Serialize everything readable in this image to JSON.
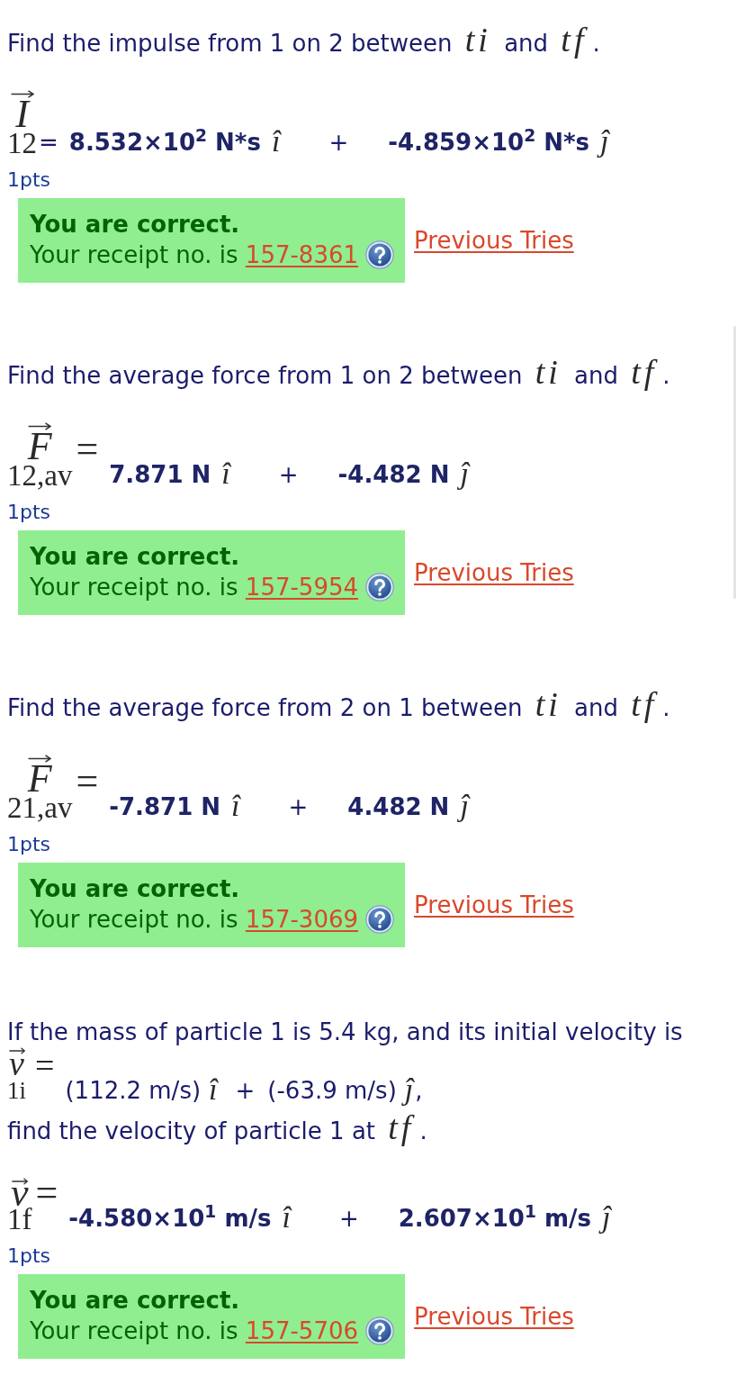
{
  "parts": [
    {
      "prompt": [
        {
          "kind": "text",
          "text": "Find the impulse from 1 on 2 between *ti* and *tf*."
        }
      ],
      "answer": {
        "label": {
          "symbol": "I",
          "subscript": "12"
        },
        "equals": "=",
        "terms": [
          {
            "kind": "component",
            "value": "8.532×10$^{2}$ N*s",
            "unit": "î"
          },
          {
            "kind": "operator",
            "text": "+"
          },
          {
            "kind": "component",
            "value": "-4.859×10$^{2}$ N*s",
            "unit": "ĵ"
          }
        ]
      },
      "points": "1pts",
      "feedback": {
        "correct": true,
        "status": "You are correct.",
        "receipt_text": "Your receipt no. is",
        "receipt": "157-8361"
      },
      "previous_tries": "Previous Tries"
    },
    {
      "prompt": [
        {
          "kind": "text",
          "text": "Find the average force from 1 on 2 between *ti* and *tf*."
        }
      ],
      "answer": {
        "label": {
          "symbol": "F",
          "subscript": "12,av",
          "equals": "="
        },
        "terms": [
          {
            "kind": "component",
            "value": "7.871 N",
            "unit": "î"
          },
          {
            "kind": "operator",
            "text": "+"
          },
          {
            "kind": "component",
            "value": "-4.482 N",
            "unit": "ĵ"
          }
        ]
      },
      "points": "1pts",
      "feedback": {
        "correct": true,
        "status": "You are correct.",
        "receipt_text": "Your receipt no. is",
        "receipt": "157-5954"
      },
      "previous_tries": "Previous Tries"
    },
    {
      "prompt": [
        {
          "kind": "text",
          "text": "Find the average force from 2 on 1 between *ti* and *tf*."
        }
      ],
      "answer": {
        "label": {
          "symbol": "F",
          "subscript": "21,av",
          "equals": "="
        },
        "terms": [
          {
            "kind": "component",
            "value": "-7.871 N",
            "unit": "î"
          },
          {
            "kind": "operator",
            "text": "+"
          },
          {
            "kind": "component",
            "value": "4.482 N",
            "unit": "ĵ"
          }
        ]
      },
      "points": "1pts",
      "feedback": {
        "correct": true,
        "status": "You are correct.",
        "receipt_text": "Your receipt no. is",
        "receipt": "157-3069"
      },
      "previous_tries": "Previous Tries"
    },
    {
      "prompt": [
        {
          "kind": "text",
          "text": "If the mass of particle 1 is 5.4 kg, and its initial velocity is"
        },
        {
          "kind": "vector",
          "label": {
            "symbol": "v",
            "subscript": "1i",
            "equals": "="
          },
          "terms": [
            {
              "kind": "component",
              "value": "(112.2 m/s)",
              "unit": "î"
            },
            {
              "kind": "operator",
              "text": "+"
            },
            {
              "kind": "component",
              "value": "(-63.9 m/s)",
              "unit": "ĵ"
            },
            {
              "kind": "punctuation",
              "text": ","
            }
          ]
        },
        {
          "kind": "text",
          "text": "find the velocity of particle 1 at *tf*."
        }
      ],
      "answer": {
        "label": {
          "symbol": "v",
          "subscript": "1f",
          "equals": "="
        },
        "terms": [
          {
            "kind": "component",
            "value": "-4.580×10$^{1}$ m/s",
            "unit": "î"
          },
          {
            "kind": "operator",
            "text": "+"
          },
          {
            "kind": "component",
            "value": "2.607×10$^{1}$ m/s",
            "unit": "ĵ"
          }
        ]
      },
      "points": "1pts",
      "feedback": {
        "correct": true,
        "status": "You are correct.",
        "receipt_text": "Your receipt no. is",
        "receipt": "157-5706"
      },
      "previous_tries": "Previous Tries"
    }
  ]
}
